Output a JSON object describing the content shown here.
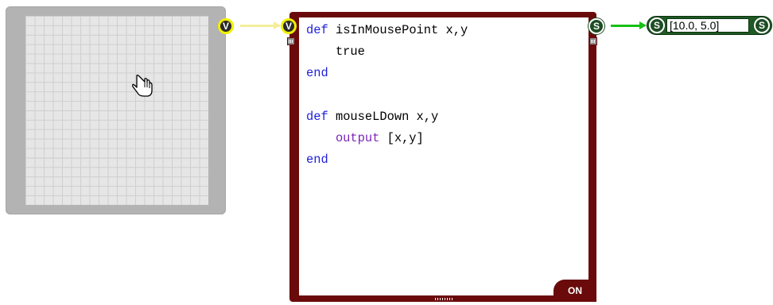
{
  "grid_panel": {
    "cursor_icon": "hand-pointer-icon"
  },
  "pins": {
    "grid_output": "V",
    "code_input": "V",
    "code_output": "S",
    "output_node_input": "S",
    "output_node_output": "S"
  },
  "code_block": {
    "lines": [
      {
        "kw": "def",
        "text": " isInMousePoint x,y"
      },
      {
        "text": "    true"
      },
      {
        "kw": "end"
      },
      {
        "text": ""
      },
      {
        "kw": "def",
        "text": " mouseLDown x,y"
      },
      {
        "fn": "    output",
        "text": " [x,y]"
      },
      {
        "kw": "end"
      }
    ],
    "status_badge": "ON",
    "colors": {
      "frame": "#6a0a0a",
      "keyword": "#1f1fdb",
      "function": "#7a24b8"
    }
  },
  "output_node": {
    "value": "[10.0, 5.0]"
  },
  "wires": {
    "input_wire_color": "#f3ef9a",
    "output_wire_color": "#16c016"
  }
}
